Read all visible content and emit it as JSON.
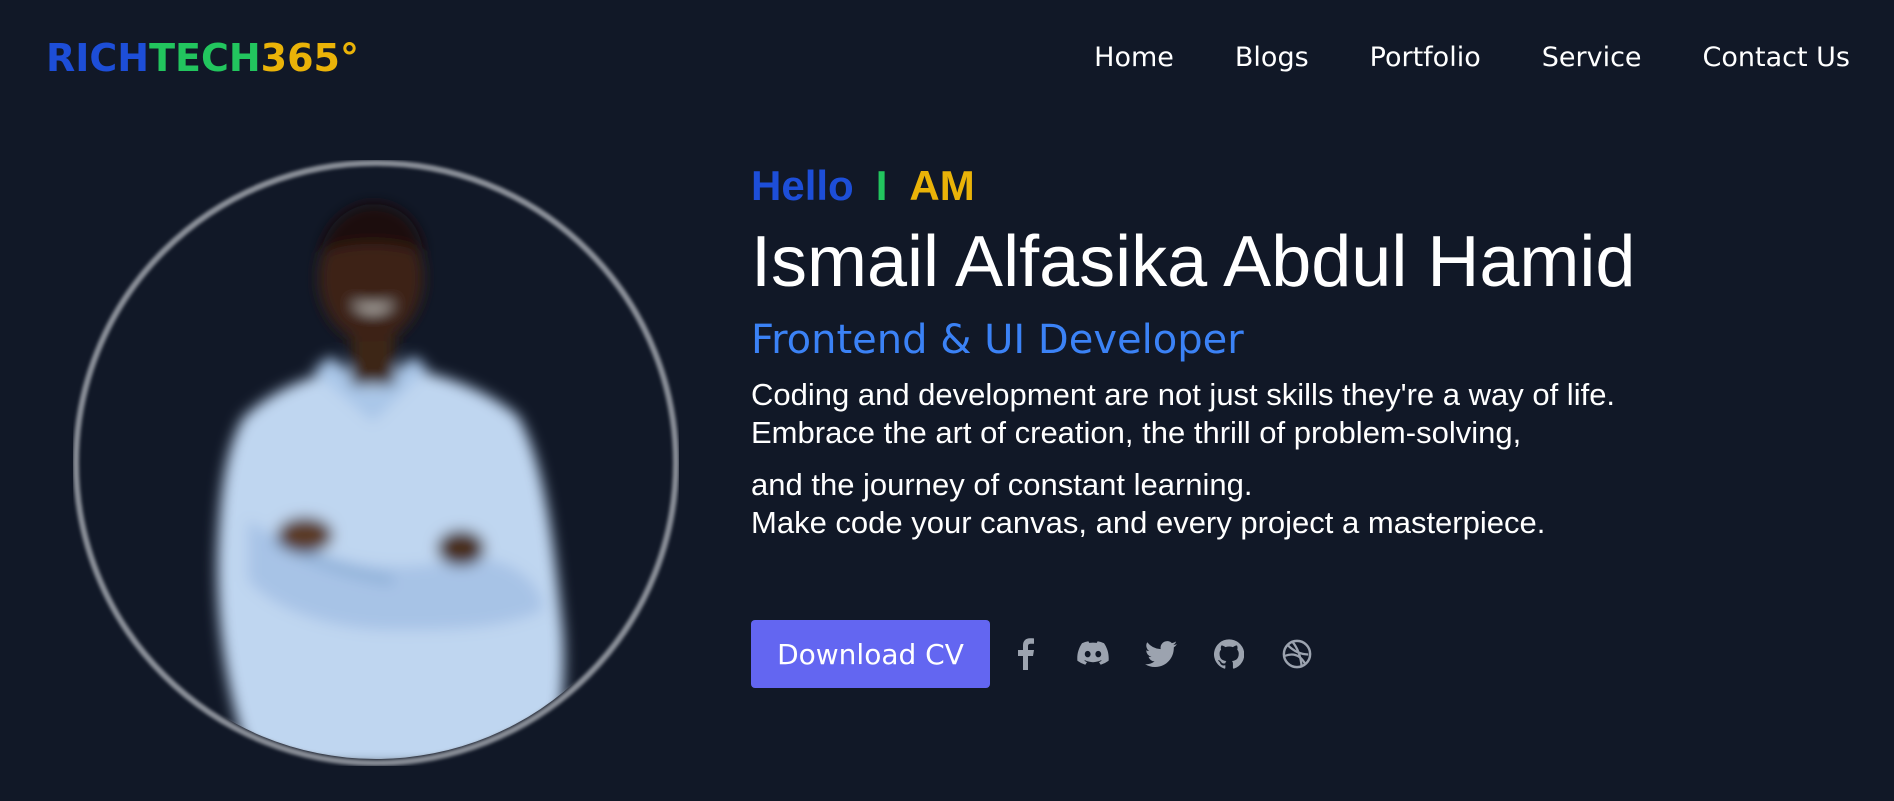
{
  "logo": {
    "part1": "RICH",
    "part2": "TECH",
    "part3": "365°",
    "colors": {
      "part1": "#1d4ed8",
      "part2": "#22c55e",
      "part3": "#eab308"
    }
  },
  "nav": {
    "items": [
      {
        "label": "Home"
      },
      {
        "label": "Blogs"
      },
      {
        "label": "Portfolio"
      },
      {
        "label": "Service"
      },
      {
        "label": "Contact Us"
      }
    ]
  },
  "hero": {
    "greeting": {
      "hello": "Hello",
      "i": "I",
      "am": "AM"
    },
    "name": "Ismail Alfasika Abdul Hamid",
    "role": "Frontend & UI Developer",
    "bio": [
      "Coding and development are not just skills they're a way of life.",
      "Embrace the art of creation, the thrill of problem-solving,",
      "and the journey of constant learning.",
      "Make code your canvas, and every project a masterpiece."
    ],
    "cta_label": "Download CV",
    "social_icons": [
      "facebook-icon",
      "discord-icon",
      "twitter-icon",
      "github-icon",
      "dribbble-icon"
    ]
  },
  "colors": {
    "background": "#111827",
    "accent": "#6366f1",
    "role": "#3b82f6",
    "icon": "#9ca3af"
  }
}
